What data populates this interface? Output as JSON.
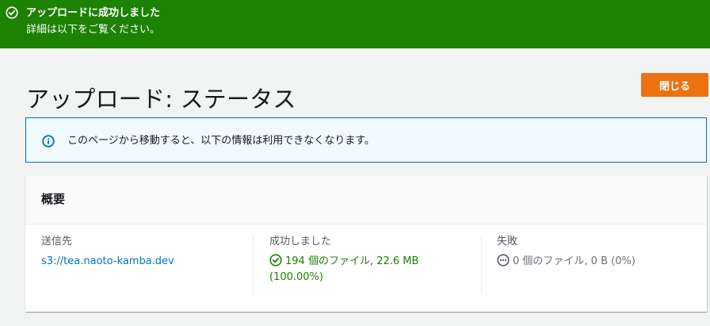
{
  "flash": {
    "title": "アップロードに成功しました",
    "message": "詳細は以下をご覧ください。",
    "icon": "check-circle-icon",
    "color": "#1d8102"
  },
  "header": {
    "title": "アップロード: ステータス",
    "close_label": "閉じる",
    "close_color": "#ec7211"
  },
  "alert": {
    "icon": "info-circle-icon",
    "text": "このページから移動すると、以下の情報は利用できなくなります。"
  },
  "summary": {
    "heading": "概要",
    "destination": {
      "label": "送信先",
      "value": "s3://tea.naoto-kamba.dev"
    },
    "succeeded": {
      "label": "成功しました",
      "line1": "194 個のファイル, 22.6 MB",
      "line2": "(100.00%)",
      "icon": "check-circle-icon"
    },
    "failed": {
      "label": "失敗",
      "value": "0 個のファイル, 0 B (0%)",
      "icon": "more-circle-icon"
    }
  }
}
